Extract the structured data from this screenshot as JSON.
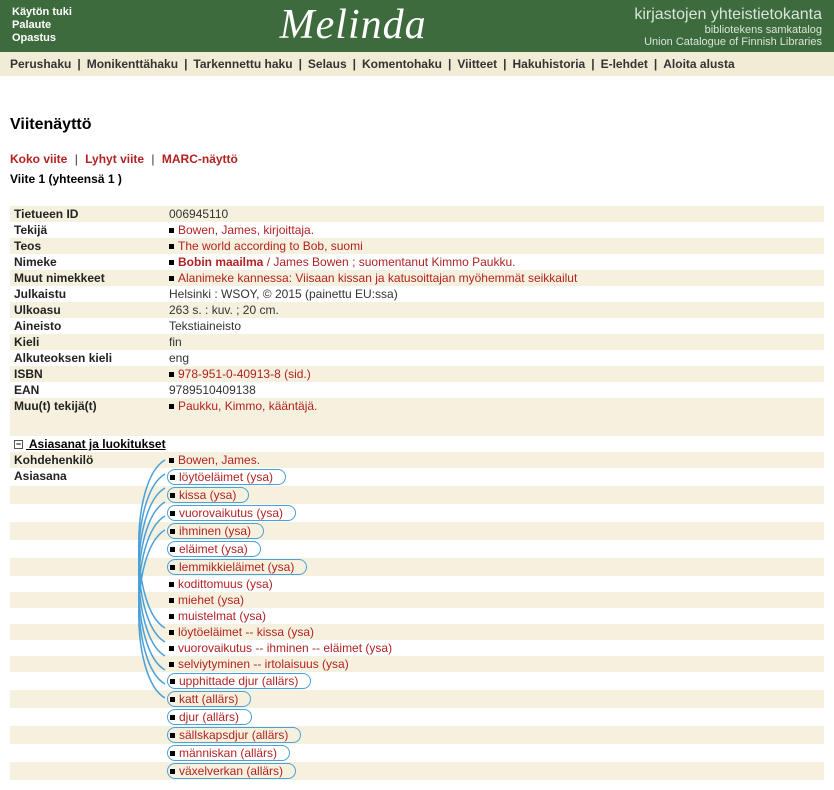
{
  "header": {
    "left_links": [
      "Käytön tuki",
      "Palaute",
      "Opastus"
    ],
    "logo": "Melinda",
    "right1": "kirjastojen yhteistietokanta",
    "right2": "bibliotekens samkatalog",
    "right3": "Union Catalogue of Finnish Libraries"
  },
  "nav": [
    "Perushaku",
    "Monikenttähaku",
    "Tarkennettu haku",
    "Selaus",
    "Komentohaku",
    "Viitteet",
    "Hakuhistoria",
    "E-lehdet",
    "Aloita alusta"
  ],
  "page_title": "Viitenäyttö",
  "tabs": [
    "Koko viite",
    "Lyhyt viite",
    "MARC-näyttö"
  ],
  "rec_count": "Viite 1 (yhteensä 1 )",
  "fields": [
    {
      "label": "Tietueen ID",
      "value": "006945110",
      "link": false,
      "alt": true
    },
    {
      "label": "Tekijä",
      "value": "Bowen, James, kirjoittaja.",
      "link": true,
      "alt": false
    },
    {
      "label": "Teos",
      "value": "The world according to Bob, suomi",
      "link": true,
      "alt": true
    },
    {
      "label": "Nimeke",
      "value_html": true,
      "bold_part": "Bobin maailma",
      "rest": " / James Bowen ; suomentanut Kimmo Paukku.",
      "link": true,
      "alt": false
    },
    {
      "label": "Muut nimekkeet",
      "value": "Alanimeke kannessa: Viisaan kissan ja katusoittajan myöhemmät seikkailut",
      "link": true,
      "alt": true
    },
    {
      "label": "Julkaistu",
      "value": "Helsinki : WSOY, © 2015 (painettu EU:ssa)",
      "link": false,
      "alt": false
    },
    {
      "label": "Ulkoasu",
      "value": "263 s. :  kuv. ;  20 cm.",
      "link": false,
      "alt": true
    },
    {
      "label": "Aineisto",
      "value": "Tekstiaineisto",
      "link": false,
      "alt": false
    },
    {
      "label": "Kieli",
      "value": "fin",
      "link": false,
      "alt": true
    },
    {
      "label": "Alkuteoksen kieli",
      "value": "eng",
      "link": false,
      "alt": false
    },
    {
      "label": "ISBN",
      "value": "978-951-0-40913-8 (sid.)",
      "link": true,
      "alt": true
    },
    {
      "label": "EAN",
      "value": "9789510409138",
      "link": false,
      "alt": false
    },
    {
      "label": "Muu(t) tekijä(t)",
      "value": "Paukku, Kimmo, kääntäjä.",
      "link": true,
      "alt": true
    }
  ],
  "section_header": "Asiasanat ja luokitukset",
  "kohdehenkilo_label": "Kohdehenkilö",
  "kohdehenkilo_value": "Bowen, James.",
  "asiasana_label": "Asiasana",
  "subjects": [
    {
      "text": "löytöeläimet (ysa)",
      "circled": true
    },
    {
      "text": "kissa (ysa)",
      "circled": true
    },
    {
      "text": "vuorovaikutus (ysa)",
      "circled": true
    },
    {
      "text": "ihminen (ysa)",
      "circled": true
    },
    {
      "text": "eläimet (ysa)",
      "circled": true
    },
    {
      "text": "lemmikkieläimet (ysa)",
      "circled": true
    },
    {
      "text": "kodittomuus (ysa)",
      "circled": false
    },
    {
      "text": "miehet (ysa)",
      "circled": false
    },
    {
      "text": "muistelmat (ysa)",
      "circled": false
    },
    {
      "text": "löytöeläimet -- kissa (ysa)",
      "circled": false
    },
    {
      "text": "vuorovaikutus -- ihminen -- eläimet (ysa)",
      "circled": false
    },
    {
      "text": "selviytyminen -- irtolaisuus (ysa)",
      "circled": false
    },
    {
      "text": "upphittade djur (allärs)",
      "circled": true
    },
    {
      "text": "katt (allärs)",
      "circled": true
    },
    {
      "text": "djur (allärs)",
      "circled": true
    },
    {
      "text": "sällskapsdjur (allärs)",
      "circled": true
    },
    {
      "text": "människan (allärs)",
      "circled": true
    },
    {
      "text": "växelverkan (allärs)",
      "circled": true
    }
  ]
}
